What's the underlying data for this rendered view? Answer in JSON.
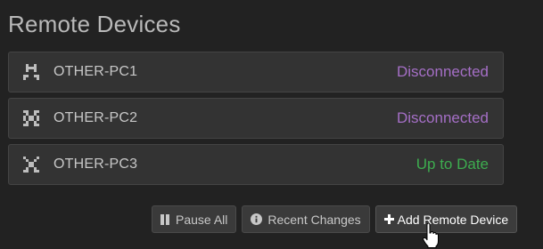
{
  "section": {
    "title": "Remote Devices"
  },
  "devices": [
    {
      "name": "OTHER-PC1",
      "status": "Disconnected",
      "icon": "device-identicon-1"
    },
    {
      "name": "OTHER-PC2",
      "status": "Disconnected",
      "icon": "device-identicon-2"
    },
    {
      "name": "OTHER-PC3",
      "status": "Up to Date",
      "icon": "device-identicon-3"
    }
  ],
  "actions": {
    "pause_all": "Pause All",
    "recent_changes": "Recent Changes",
    "add_remote_device": "Add Remote Device",
    "pause_icon": "pause-icon",
    "info_icon": "info-icon",
    "plus_icon": "plus-icon"
  },
  "colors": {
    "background": "#222222",
    "panel": "#333333",
    "disconnected": "#a56fc6",
    "up_to_date": "#3dac4f"
  }
}
